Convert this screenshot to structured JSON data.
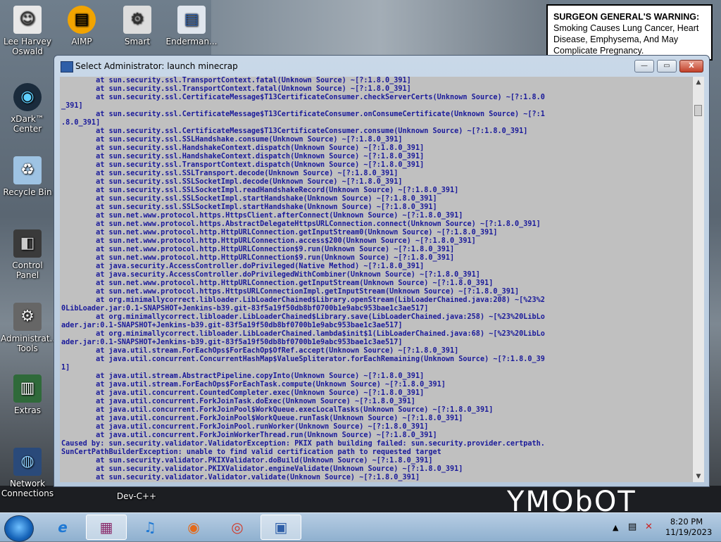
{
  "desktop": {
    "icons": [
      {
        "label": "Lee Harvey Oswald",
        "icon": "person-icon"
      },
      {
        "label": "AIMP",
        "icon": "aimp-icon"
      },
      {
        "label": "Smart",
        "icon": "smart-icon"
      },
      {
        "label": "Enderman...",
        "icon": "enderman-icon"
      },
      {
        "label": "xDark™ Center",
        "icon": "xdark-icon"
      },
      {
        "label": "Recycle Bin",
        "icon": "recycle-bin-icon"
      },
      {
        "label": "Control Panel",
        "icon": "control-panel-icon"
      },
      {
        "label": "Administrat... Tools",
        "icon": "admin-tools-icon"
      },
      {
        "label": "Extras",
        "icon": "extras-icon"
      },
      {
        "label": "Network Connections",
        "icon": "network-icon"
      },
      {
        "label": "Dev-C++",
        "icon": "devcpp-icon"
      }
    ],
    "wallpaper_text": "YMObOT"
  },
  "warning": {
    "heading": "SURGEON GENERAL'S WARNING:",
    "body": "Smoking Causes Lung Cancer, Heart Disease, Emphysema, And May Complicate Pregnancy."
  },
  "window": {
    "title": "Select Administrator:  launch minecrap",
    "controls": {
      "minimize": "—",
      "maximize": "▭",
      "close": "X"
    }
  },
  "console_lines": [
    "        at sun.security.ssl.TransportContext.fatal(Unknown Source) ~[?:1.8.0_391]",
    "        at sun.security.ssl.TransportContext.fatal(Unknown Source) ~[?:1.8.0_391]",
    "        at sun.security.ssl.CertificateMessage$T13CertificateConsumer.checkServerCerts(Unknown Source) ~[?:1.8.0",
    "_391]",
    "        at sun.security.ssl.CertificateMessage$T13CertificateConsumer.onConsumeCertificate(Unknown Source) ~[?:1",
    ".8.0_391]",
    "        at sun.security.ssl.CertificateMessage$T13CertificateConsumer.consume(Unknown Source) ~[?:1.8.0_391]",
    "        at sun.security.ssl.SSLHandshake.consume(Unknown Source) ~[?:1.8.0_391]",
    "        at sun.security.ssl.HandshakeContext.dispatch(Unknown Source) ~[?:1.8.0_391]",
    "        at sun.security.ssl.HandshakeContext.dispatch(Unknown Source) ~[?:1.8.0_391]",
    "        at sun.security.ssl.TransportContext.dispatch(Unknown Source) ~[?:1.8.0_391]",
    "        at sun.security.ssl.SSLTransport.decode(Unknown Source) ~[?:1.8.0_391]",
    "        at sun.security.ssl.SSLSocketImpl.decode(Unknown Source) ~[?:1.8.0_391]",
    "        at sun.security.ssl.SSLSocketImpl.readHandshakeRecord(Unknown Source) ~[?:1.8.0_391]",
    "        at sun.security.ssl.SSLSocketImpl.startHandshake(Unknown Source) ~[?:1.8.0_391]",
    "        at sun.security.ssl.SSLSocketImpl.startHandshake(Unknown Source) ~[?:1.8.0_391]",
    "        at sun.net.www.protocol.https.HttpsClient.afterConnect(Unknown Source) ~[?:1.8.0_391]",
    "        at sun.net.www.protocol.https.AbstractDelegateHttpsURLConnection.connect(Unknown Source) ~[?:1.8.0_391]",
    "        at sun.net.www.protocol.http.HttpURLConnection.getInputStream0(Unknown Source) ~[?:1.8.0_391]",
    "        at sun.net.www.protocol.http.HttpURLConnection.access$200(Unknown Source) ~[?:1.8.0_391]",
    "        at sun.net.www.protocol.http.HttpURLConnection$9.run(Unknown Source) ~[?:1.8.0_391]",
    "        at sun.net.www.protocol.http.HttpURLConnection$9.run(Unknown Source) ~[?:1.8.0_391]",
    "        at java.security.AccessController.doPrivileged(Native Method) ~[?:1.8.0_391]",
    "        at java.security.AccessController.doPrivilegedWithCombiner(Unknown Source) ~[?:1.8.0_391]",
    "        at sun.net.www.protocol.http.HttpURLConnection.getInputStream(Unknown Source) ~[?:1.8.0_391]",
    "        at sun.net.www.protocol.https.HttpsURLConnectionImpl.getInputStream(Unknown Source) ~[?:1.8.0_391]",
    "        at org.minimallycorrect.libloader.LibLoaderChained$Library.openStream(LibLoaderChained.java:208) ~[%23%2",
    "0LibLoader.jar:0.1-SNAPSHOT+Jenkins-b39.git-83f5a19f50db8bf0700b1e9abc953bae1c3ae517]",
    "        at org.minimallycorrect.libloader.LibLoaderChained$Library.save(LibLoaderChained.java:258) ~[%23%20LibLo",
    "ader.jar:0.1-SNAPSHOT+Jenkins-b39.git-83f5a19f50db8bf0700b1e9abc953bae1c3ae517]",
    "        at org.minimallycorrect.libloader.LibLoaderChained.lambda$init$1(LibLoaderChained.java:68) ~[%23%20LibLo",
    "ader.jar:0.1-SNAPSHOT+Jenkins-b39.git-83f5a19f50db8bf0700b1e9abc953bae1c3ae517]",
    "        at java.util.stream.ForEachOps$ForEachOp$OfRef.accept(Unknown Source) ~[?:1.8.0_391]",
    "        at java.util.concurrent.ConcurrentHashMap$ValueSpliterator.forEachRemaining(Unknown Source) ~[?:1.8.0_39",
    "1]",
    "        at java.util.stream.AbstractPipeline.copyInto(Unknown Source) ~[?:1.8.0_391]",
    "        at java.util.stream.ForEachOps$ForEachTask.compute(Unknown Source) ~[?:1.8.0_391]",
    "        at java.util.concurrent.CountedCompleter.exec(Unknown Source) ~[?:1.8.0_391]",
    "        at java.util.concurrent.ForkJoinTask.doExec(Unknown Source) ~[?:1.8.0_391]",
    "        at java.util.concurrent.ForkJoinPool$WorkQueue.execLocalTasks(Unknown Source) ~[?:1.8.0_391]",
    "        at java.util.concurrent.ForkJoinPool$WorkQueue.runTask(Unknown Source) ~[?:1.8.0_391]",
    "        at java.util.concurrent.ForkJoinPool.runWorker(Unknown Source) ~[?:1.8.0_391]",
    "        at java.util.concurrent.ForkJoinWorkerThread.run(Unknown Source) ~[?:1.8.0_391]",
    "Caused by: sun.security.validator.ValidatorException: PKIX path building failed: sun.security.provider.certpath.",
    "SunCertPathBuilderException: unable to find valid certification path to requested target",
    "        at sun.security.validator.PKIXValidator.doBuild(Unknown Source) ~[?:1.8.0_391]",
    "        at sun.security.validator.PKIXValidator.engineValidate(Unknown Source) ~[?:1.8.0_391]",
    "        at sun.security.validator.Validator.validate(Unknown Source) ~[?:1.8.0_391]"
  ],
  "taskbar": {
    "apps": [
      {
        "name": "internet-explorer-icon",
        "glyph": "e"
      },
      {
        "name": "winrar-icon",
        "glyph": "▦"
      },
      {
        "name": "itunes-icon",
        "glyph": "♫"
      },
      {
        "name": "firefox-icon",
        "glyph": "◉"
      },
      {
        "name": "chrome-icon",
        "glyph": "◎"
      },
      {
        "name": "console-icon",
        "glyph": "▣"
      }
    ],
    "clock_time": "8:20 PM",
    "clock_date": "11/19/2023"
  },
  "colors": {
    "console_bg": "#c0c0c0",
    "console_text": "#1a1a9a",
    "highlight_text": "#ffff55"
  }
}
